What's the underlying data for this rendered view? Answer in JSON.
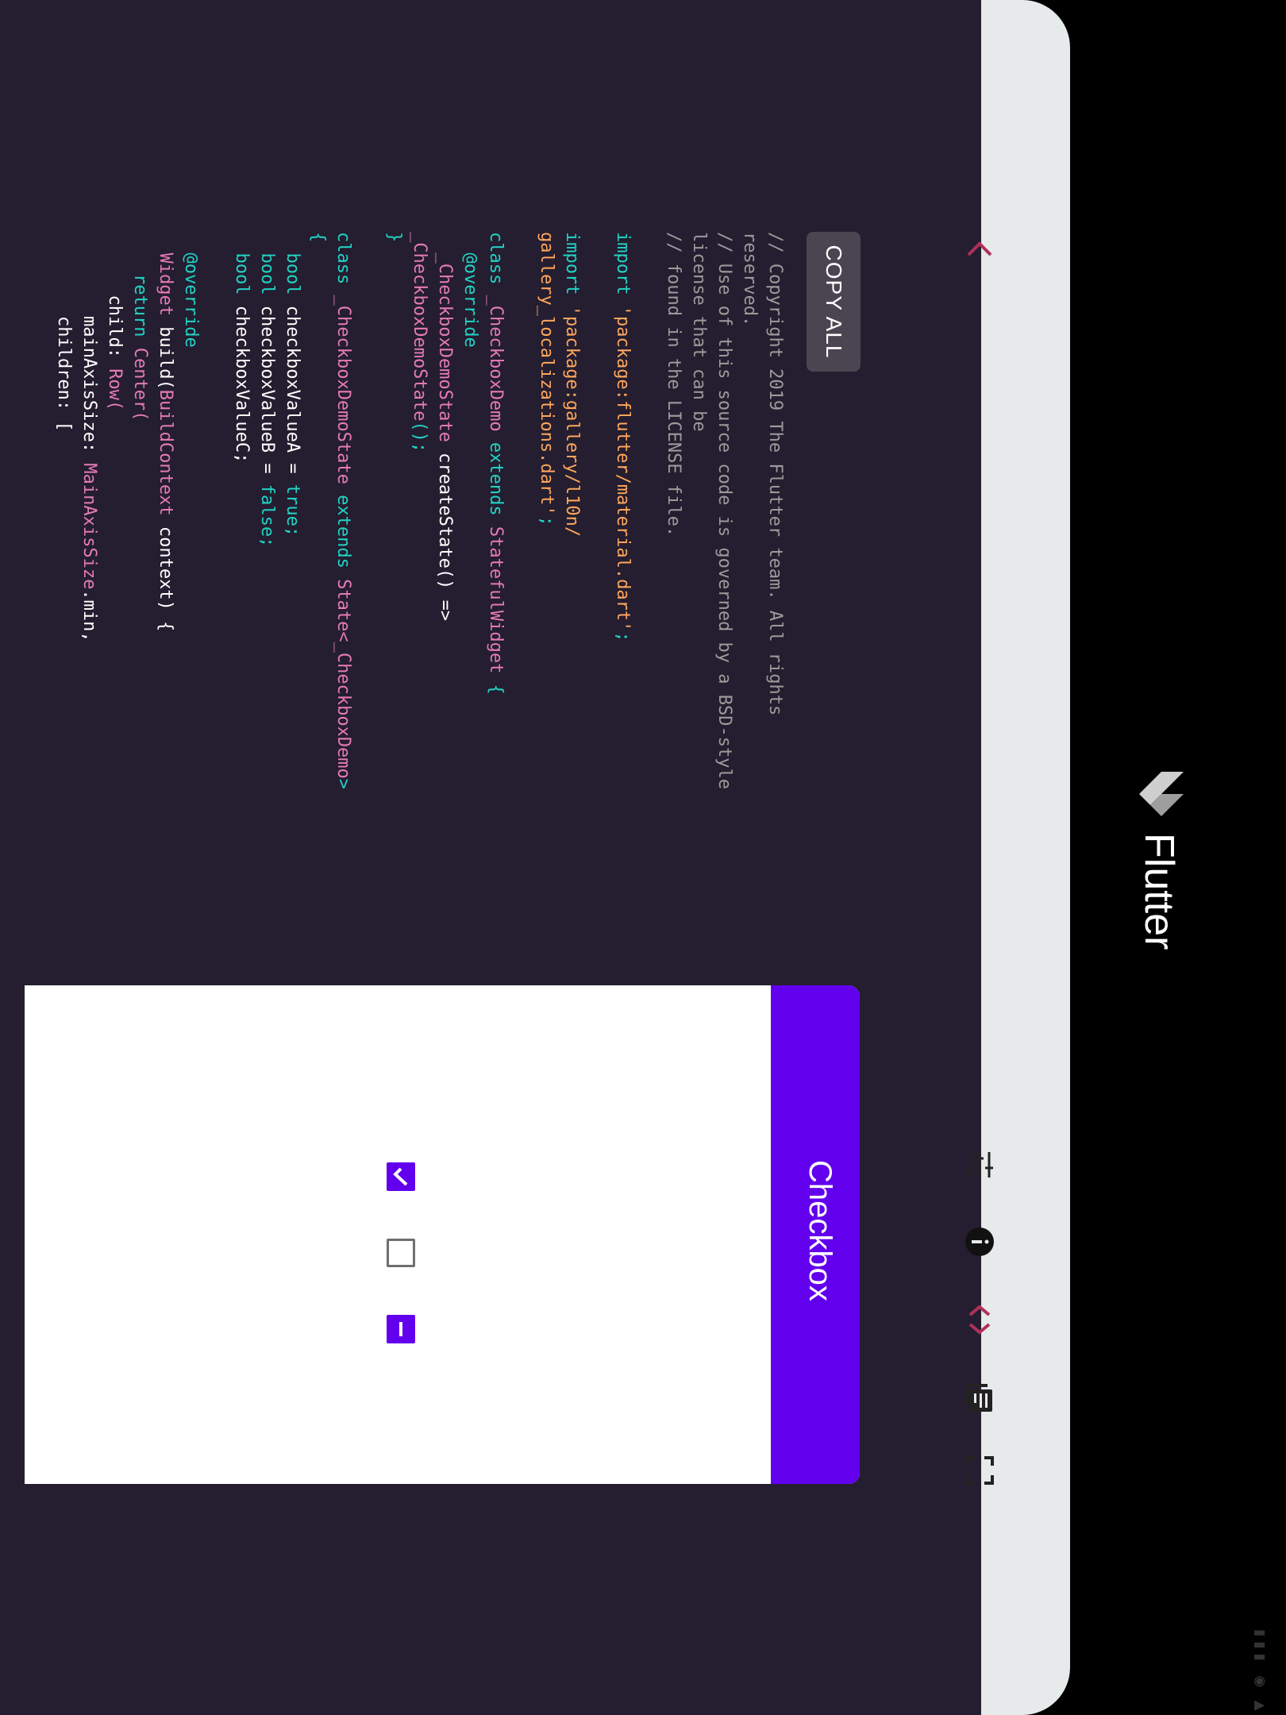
{
  "app": {
    "title": "Flutter"
  },
  "toolbar": {
    "back_icon": "chevron-back-icon",
    "tune_icon": "tune-icon",
    "info_icon": "info-icon",
    "code_icon": "code-icon",
    "docs_icon": "library-books-icon",
    "fullscreen_icon": "fullscreen-icon",
    "accent": "#b0305a"
  },
  "code_panel": {
    "copy_all_label": "COPY ALL",
    "lines": [
      [
        {
          "t": "// Copyright 2019 The Flutter team. All rights",
          "c": "comment"
        }
      ],
      [
        {
          "t": "reserved.",
          "c": "comment"
        }
      ],
      [
        {
          "t": "// Use of this source code is governed by a BSD-style",
          "c": "comment"
        }
      ],
      [
        {
          "t": "license that can be",
          "c": "comment"
        }
      ],
      [
        {
          "t": "// found in the LICENSE file.",
          "c": "comment"
        }
      ],
      [],
      [
        {
          "t": "import ",
          "c": "kw"
        },
        {
          "t": "'package:flutter/material.dart'",
          "c": "str"
        },
        {
          "t": ";",
          "c": "kw"
        }
      ],
      [],
      [
        {
          "t": "import ",
          "c": "kw"
        },
        {
          "t": "'package:gallery/l10n/",
          "c": "str"
        }
      ],
      [
        {
          "t": "gallery_localizations.dart'",
          "c": "str"
        },
        {
          "t": ";",
          "c": "kw"
        }
      ],
      [],
      [
        {
          "t": "class ",
          "c": "kw"
        },
        {
          "t": "_CheckboxDemo ",
          "c": "cls"
        },
        {
          "t": "extends ",
          "c": "kw"
        },
        {
          "t": "StatefulWidget ",
          "c": "cls"
        },
        {
          "t": "{",
          "c": "kw"
        }
      ],
      [
        {
          "t": "  @override",
          "c": "kw"
        }
      ],
      [
        {
          "t": "  _CheckboxDemoState ",
          "c": "cls"
        },
        {
          "t": "createState() =>",
          "c": "plain"
        }
      ],
      [
        {
          "t": "_CheckboxDemoState",
          "c": "cls"
        },
        {
          "t": "();",
          "c": "kw"
        }
      ],
      [
        {
          "t": "}",
          "c": "kw"
        }
      ],
      [],
      [
        {
          "t": "class ",
          "c": "kw"
        },
        {
          "t": "_CheckboxDemoState ",
          "c": "cls"
        },
        {
          "t": "extends ",
          "c": "kw"
        },
        {
          "t": "State<",
          "c": "cls"
        },
        {
          "t": "_CheckboxDemo",
          "c": "cls"
        },
        {
          "t": ">",
          "c": "kw"
        }
      ],
      [
        {
          "t": "{",
          "c": "kw"
        }
      ],
      [
        {
          "t": "  bool ",
          "c": "kw"
        },
        {
          "t": "checkboxValueA = ",
          "c": "plain"
        },
        {
          "t": "true",
          "c": "kw"
        },
        {
          "t": ";",
          "c": "kw"
        }
      ],
      [
        {
          "t": "  bool ",
          "c": "kw"
        },
        {
          "t": "checkboxValueB = ",
          "c": "plain"
        },
        {
          "t": "false",
          "c": "kw"
        },
        {
          "t": ";",
          "c": "kw"
        }
      ],
      [
        {
          "t": "  bool ",
          "c": "kw"
        },
        {
          "t": "checkboxValueC;",
          "c": "plain"
        }
      ],
      [],
      [
        {
          "t": "  @override",
          "c": "kw"
        }
      ],
      [
        {
          "t": "  Widget ",
          "c": "cls"
        },
        {
          "t": "build(",
          "c": "plain"
        },
        {
          "t": "BuildContext ",
          "c": "cls"
        },
        {
          "t": "context) {",
          "c": "plain"
        }
      ],
      [
        {
          "t": "    return ",
          "c": "kw"
        },
        {
          "t": "Center(",
          "c": "cls"
        }
      ],
      [
        {
          "t": "      child: ",
          "c": "plain"
        },
        {
          "t": "Row(",
          "c": "cls"
        }
      ],
      [
        {
          "t": "        mainAxisSize: ",
          "c": "plain"
        },
        {
          "t": "MainAxisSize",
          "c": "cls"
        },
        {
          "t": ".min,",
          "c": "plain"
        }
      ],
      [
        {
          "t": "        children: [",
          "c": "plain"
        }
      ]
    ]
  },
  "demo": {
    "title": "Checkbox",
    "accent": "#6200ee",
    "checkboxes": [
      {
        "state": "checked"
      },
      {
        "state": "unchecked"
      },
      {
        "state": "indeterminate"
      }
    ]
  }
}
